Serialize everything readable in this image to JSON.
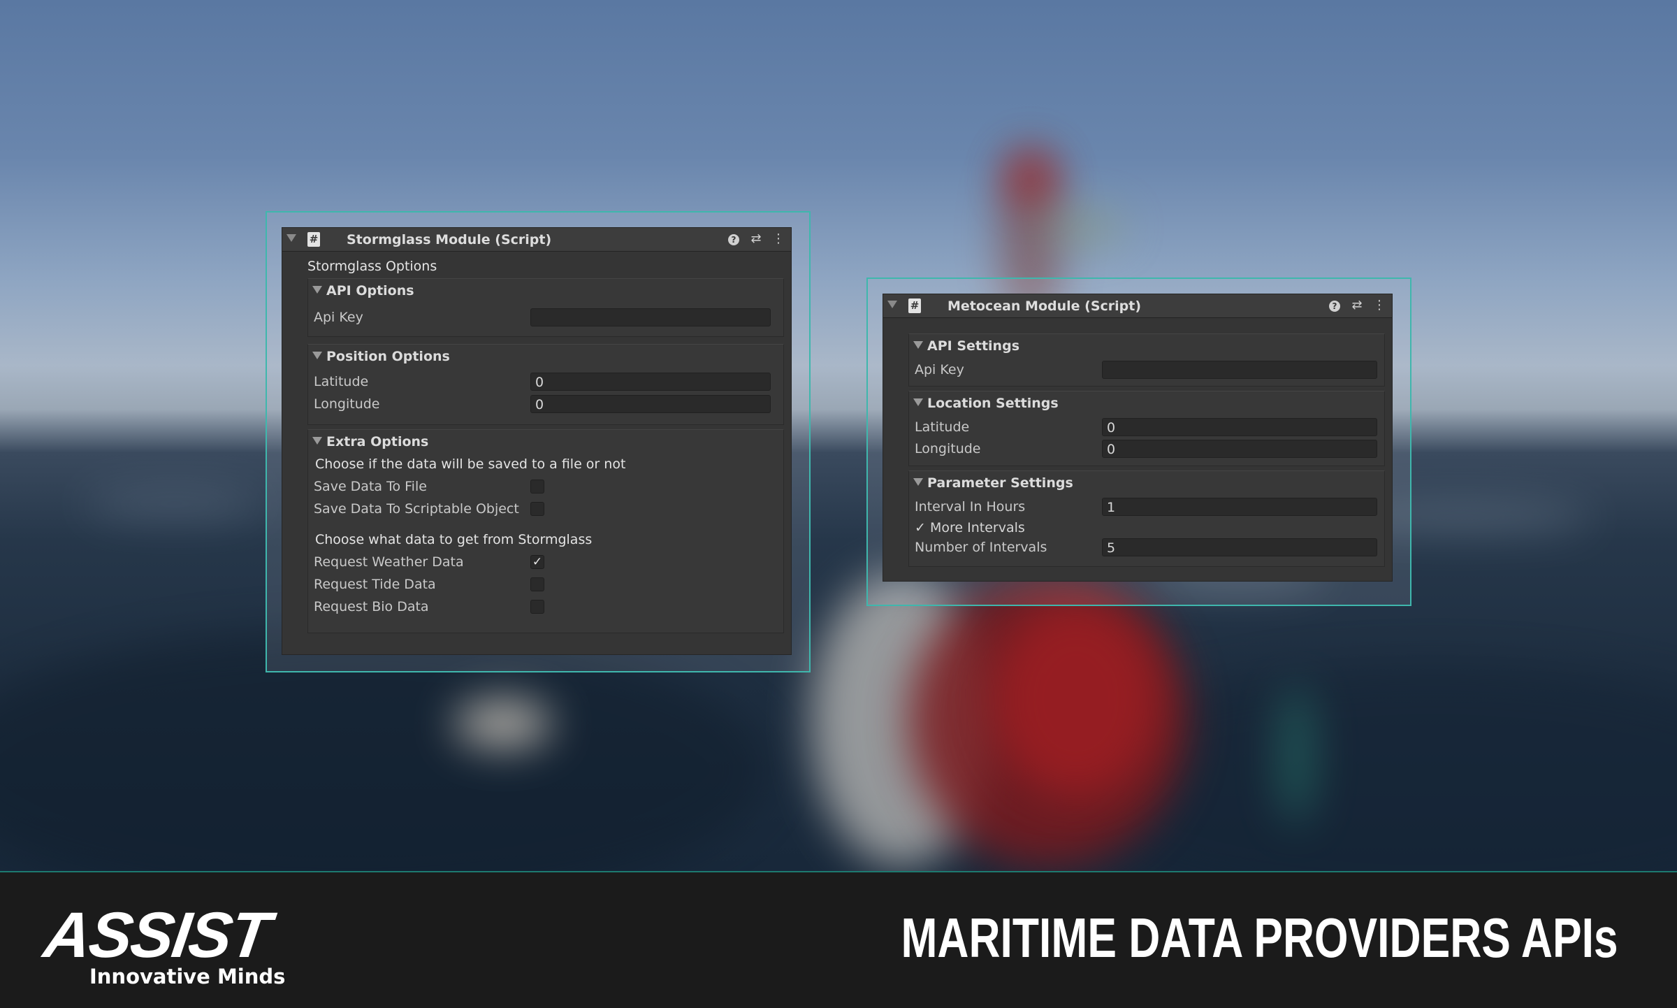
{
  "footer": {
    "logo_word": "ASSIST",
    "logo_tagline": "Innovative Minds",
    "title": "MARITIME DATA PROVIDERS APIs"
  },
  "stormglass": {
    "header_title": "Stormglass Module (Script)",
    "options_title": "Stormglass Options",
    "api_options": {
      "title": "API Options",
      "api_key_label": "Api Key",
      "api_key_value": ""
    },
    "position_options": {
      "title": "Position Options",
      "latitude_label": "Latitude",
      "latitude_value": "0",
      "longitude_label": "Longitude",
      "longitude_value": "0"
    },
    "extra_options": {
      "title": "Extra Options",
      "save_note": "Choose if the data will be saved to a file or not",
      "save_to_file_label": "Save Data To File",
      "save_to_file_checked": false,
      "save_to_scriptable_label": "Save Data To Scriptable Object",
      "save_to_scriptable_checked": false,
      "request_note": "Choose what data to get from Stormglass",
      "weather_label": "Request Weather Data",
      "weather_checked": true,
      "tide_label": "Request Tide Data",
      "tide_checked": false,
      "bio_label": "Request Bio Data",
      "bio_checked": false
    }
  },
  "metocean": {
    "header_title": "Metocean Module (Script)",
    "api_settings": {
      "title": "API Settings",
      "api_key_label": "Api Key",
      "api_key_value": ""
    },
    "location_settings": {
      "title": "Location Settings",
      "latitude_label": "Latitude",
      "latitude_value": "0",
      "longitude_label": "Longitude",
      "longitude_value": "0"
    },
    "parameter_settings": {
      "title": "Parameter Settings",
      "interval_label": "Interval In Hours",
      "interval_value": "1",
      "more_intervals_label": "More Intervals",
      "more_intervals_checked": true,
      "num_intervals_label": "Number of Intervals",
      "num_intervals_value": "5"
    }
  },
  "icons": {
    "script": "#",
    "check": "✓"
  },
  "colors": {
    "accent_frame": "#3fb7ad",
    "panel_bg": "#353535",
    "footer_bg": "#1b1b1b"
  }
}
